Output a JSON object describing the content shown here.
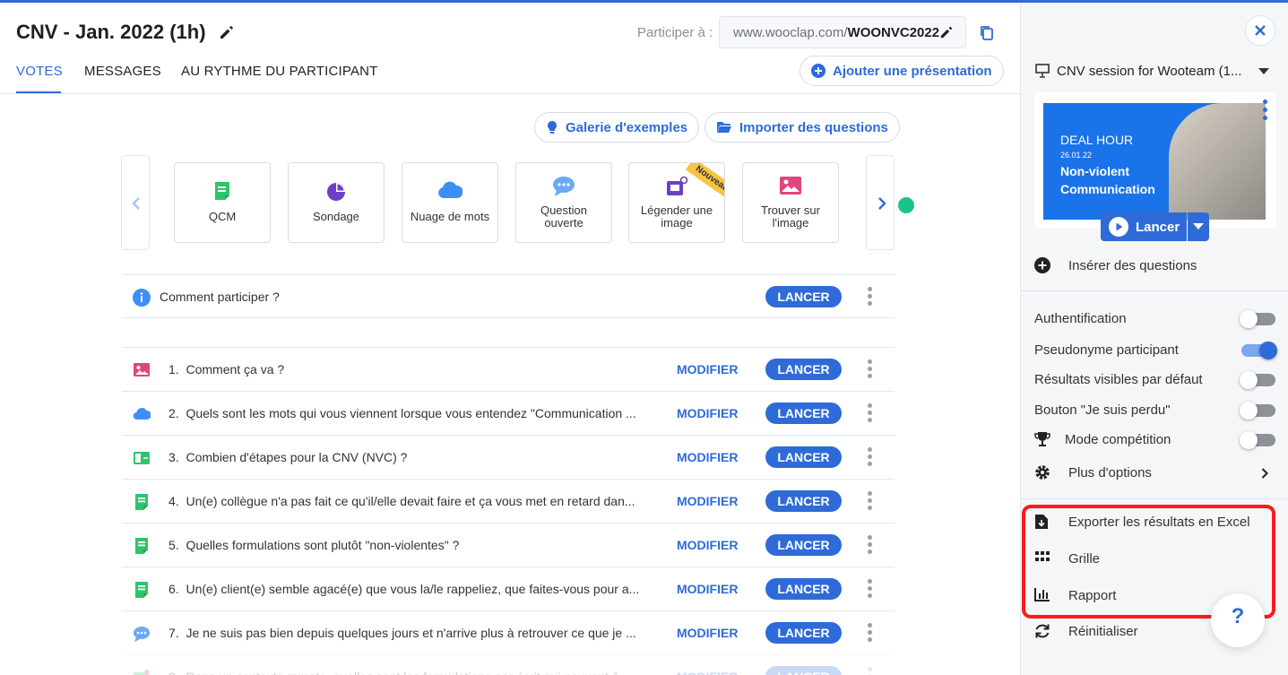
{
  "header": {
    "title": "CNV - Jan. 2022 (1h)",
    "participate_label": "Participer à :",
    "url_prefix": "www.wooclap.com/",
    "url_code": "WOONVC2022"
  },
  "tabs": [
    {
      "label": "VOTES",
      "active": true
    },
    {
      "label": "MESSAGES",
      "active": false
    },
    {
      "label": "AU RYTHME DU PARTICIPANT",
      "active": false
    }
  ],
  "actions": {
    "add_presentation": "Ajouter une présentation",
    "gallery": "Galerie d'exemples",
    "import": "Importer des questions"
  },
  "question_types": [
    {
      "label": "QCM",
      "icon": "qcm-icon"
    },
    {
      "label": "Sondage",
      "icon": "poll-icon"
    },
    {
      "label": "Nuage de mots",
      "icon": "cloud-icon"
    },
    {
      "label": "Question ouverte",
      "icon": "speech-bubble-icon"
    },
    {
      "label": "Légender une image",
      "icon": "image-label-icon",
      "badge": "Nouveau"
    },
    {
      "label": "Trouver sur l'image",
      "icon": "image-icon"
    }
  ],
  "intro_row": {
    "text": "Comment participer ?",
    "launch": "LANCER"
  },
  "questions": [
    {
      "num": "1.",
      "text": "Comment ça va ?",
      "icon": "image-icon"
    },
    {
      "num": "2.",
      "text": "Quels sont les mots qui vous viennent lorsque vous entendez \"Communication ...",
      "icon": "cloud-icon"
    },
    {
      "num": "3.",
      "text": "Combien d'étapes pour la CNV (NVC) ?",
      "icon": "number-icon"
    },
    {
      "num": "4.",
      "text": "Un(e) collègue n'a pas fait ce qu'il/elle devait faire et ça vous met en retard dan...",
      "icon": "qcm-icon"
    },
    {
      "num": "5.",
      "text": "Quelles formulations sont plutôt \"non-violentes\" ?",
      "icon": "qcm-icon"
    },
    {
      "num": "6.",
      "text": "Un(e) client(e) semble agacé(e) que vous la/le rappeliez, que faites-vous pour a...",
      "icon": "qcm-icon"
    },
    {
      "num": "7.",
      "text": "Je ne suis pas bien depuis quelques jours et n'arrive plus à retrouver ce que je ...",
      "icon": "speech-bubble-icon"
    },
    {
      "num": "8.",
      "text": "Dans un contexte remote, quelles sont les formulations par écrit qui peuvent â...",
      "icon": "image-label-icon"
    }
  ],
  "row_labels": {
    "modify": "MODIFIER",
    "launch": "LANCER"
  },
  "side": {
    "session_title": "CNV session for Wooteam (1...",
    "slide": {
      "line1": "DEAL HOUR",
      "line2": "26.01.22",
      "line3": "Non-violent Communication"
    },
    "launch": "Lancer",
    "insert_questions": "Insérer des questions",
    "settings": [
      {
        "label": "Authentification",
        "on": false
      },
      {
        "label": "Pseudonyme participant",
        "on": true
      },
      {
        "label": "Résultats visibles par défaut",
        "on": false
      },
      {
        "label": "Bouton \"Je suis perdu\"",
        "on": false
      },
      {
        "label": "Mode compétition",
        "on": false
      }
    ],
    "more_options": "Plus d'options",
    "export_excel": "Exporter les résultats en Excel",
    "grid": "Grille",
    "report": "Rapport",
    "reset": "Réinitialiser",
    "help": "?"
  },
  "colors": {
    "accent": "#2e6bd8",
    "highlight": "#ff1a1a",
    "green": "#1dc28a"
  }
}
